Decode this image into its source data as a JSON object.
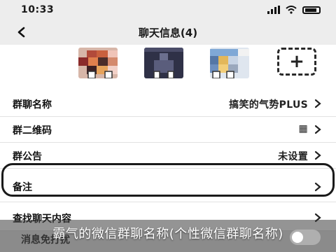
{
  "status_bar": {
    "time": "10:33"
  },
  "nav": {
    "title": "聊天信息(4)"
  },
  "members": {
    "add_symbol": "+"
  },
  "settings": [
    {
      "label": "群聊名称",
      "value": "搞笑的气势PLUS"
    },
    {
      "label": "群二维码",
      "value": "▦"
    },
    {
      "label": "群公告",
      "value": "未设置"
    },
    {
      "label": "备注",
      "value": ""
    },
    {
      "label": "查找聊天内容",
      "value": ""
    }
  ],
  "footer": {
    "partial_row_label": "消息免打扰",
    "caption": "霸气的微信群聊名称(个性微信群聊名称)"
  },
  "colors": {
    "page_bg": "#ececec",
    "row_bg": "#ffffff",
    "highlight_border": "#1a1a1a"
  }
}
